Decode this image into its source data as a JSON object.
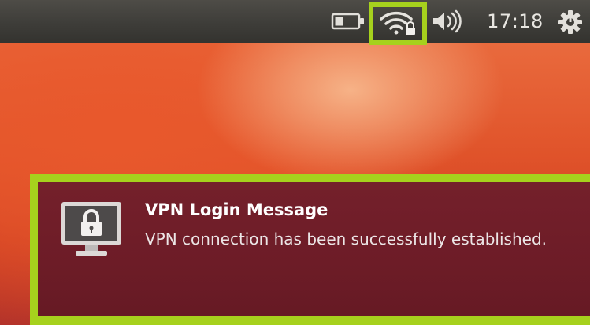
{
  "top_panel": {
    "battery": {
      "icon": "battery-icon"
    },
    "network": {
      "icon": "wifi-lock-icon",
      "highlight_color": "#a6d11d"
    },
    "volume": {
      "icon": "volume-icon"
    },
    "clock": "17:18",
    "session": {
      "icon": "gear-icon"
    }
  },
  "notification": {
    "icon": "lock-monitor-icon",
    "title": "VPN Login Message",
    "body": "VPN connection has been successfully established.",
    "background_color": "#6d1c27",
    "highlight_color": "#a6d11d"
  }
}
